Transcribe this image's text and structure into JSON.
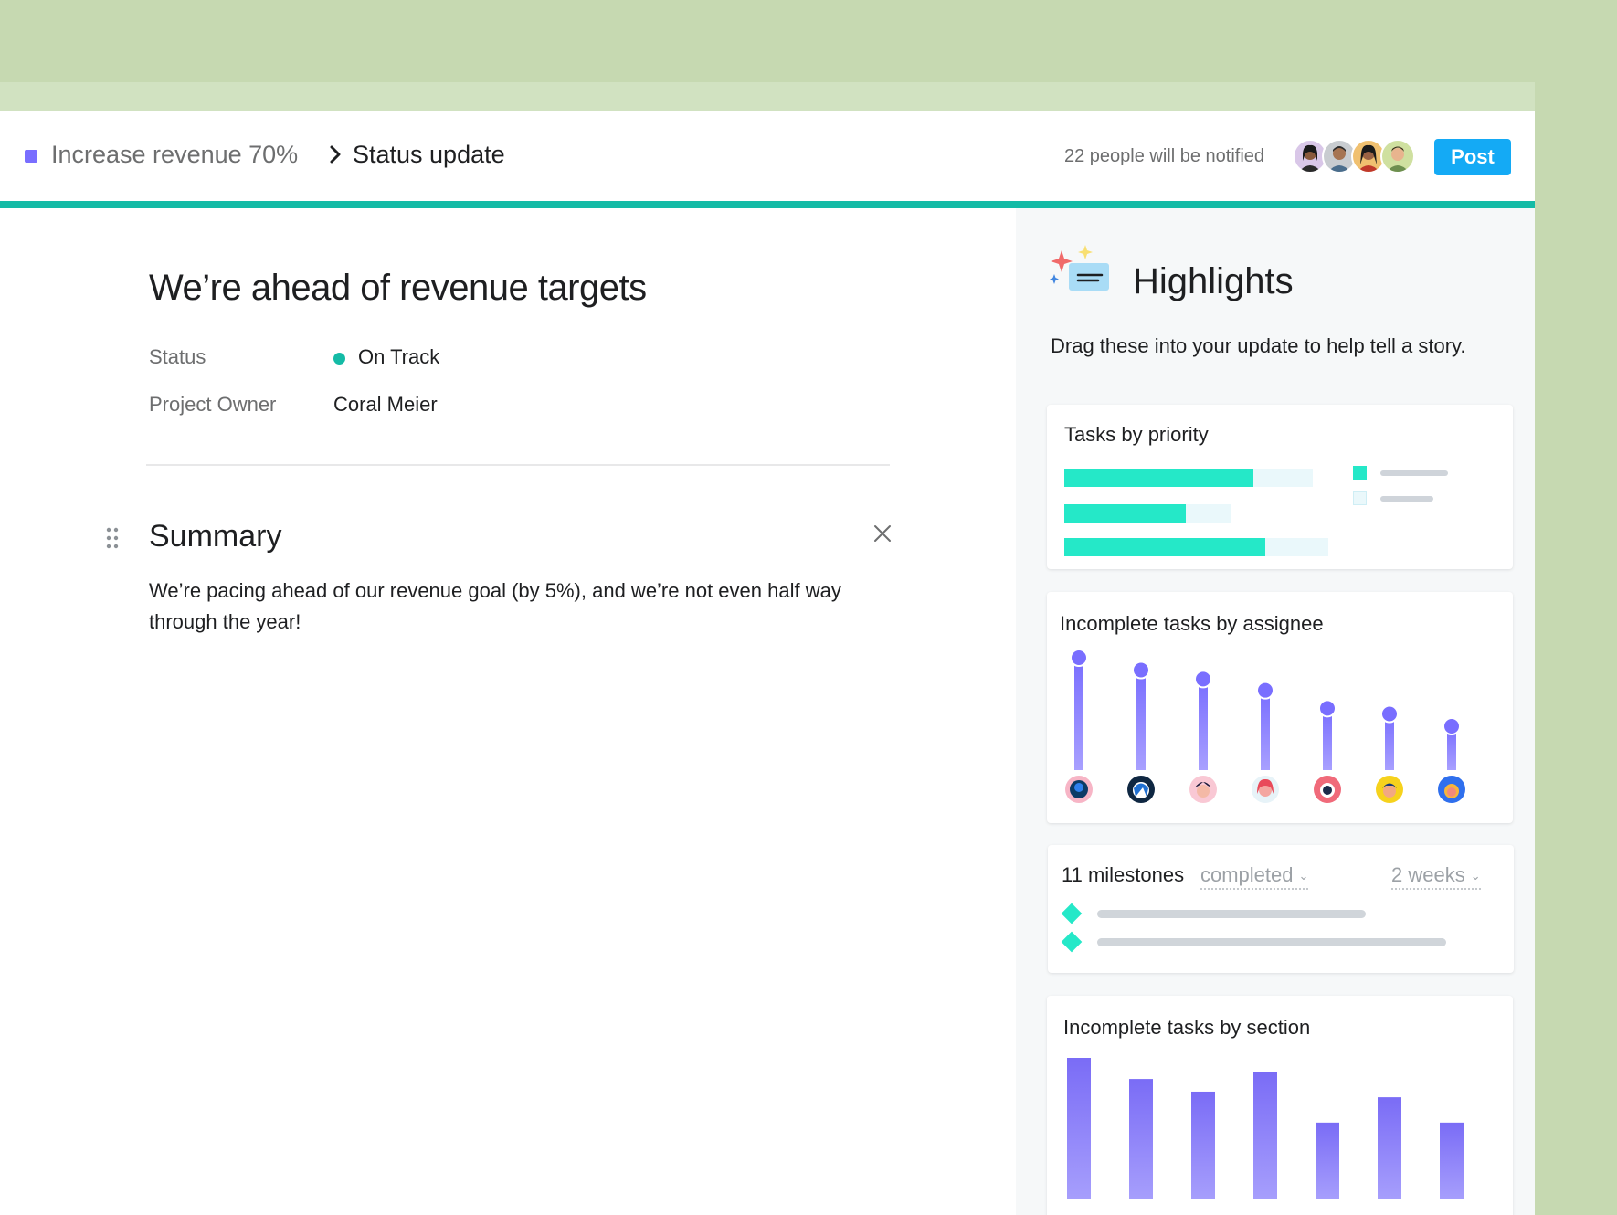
{
  "header": {
    "project_name": "Increase revenue 70%",
    "page_name": "Status update",
    "notify_text": "22 people will be notified",
    "post_label": "Post",
    "avatars": [
      "avatar-1",
      "avatar-2",
      "avatar-3",
      "avatar-4"
    ]
  },
  "update": {
    "title": "We’re ahead of revenue targets",
    "fields": {
      "status_label": "Status",
      "status_value": "On Track",
      "owner_label": "Project Owner",
      "owner_value": "Coral Meier"
    },
    "summary": {
      "heading": "Summary",
      "body": "We’re pacing ahead of our revenue goal (by 5%), and we’re not even half way through the year!"
    }
  },
  "highlights": {
    "title": "Highlights",
    "subtitle": "Drag these into your update to help tell a story.",
    "cards": {
      "tasks_by_priority": {
        "title": "Tasks by priority"
      },
      "by_assignee": {
        "title": "Incomplete tasks by assignee"
      },
      "milestones": {
        "title": "11 milestones",
        "filter_value": "completed",
        "range_value": "2 weeks"
      },
      "by_section": {
        "title": "Incomplete tasks by section"
      }
    }
  },
  "colors": {
    "accent": "#796eff",
    "status_on_track": "#14bba6",
    "post_button": "#14aaf5",
    "chart_teal": "#25e8c8",
    "chart_purple": "#796eff",
    "background": "#c6d9b1"
  },
  "chart_data": [
    {
      "type": "bar",
      "orientation": "horizontal",
      "categories": [
        "",
        "",
        ""
      ],
      "series": [
        {
          "values": [
            0.76,
            0.73,
            0.76
          ]
        }
      ]
    },
    {
      "type": "bar",
      "categories": [
        "",
        "",
        "",
        "",
        "",
        "",
        ""
      ],
      "values": [
        100,
        89,
        81,
        71,
        55,
        50,
        39
      ]
    },
    {
      "type": "bar",
      "categories": [
        "",
        "",
        "",
        "",
        "",
        "",
        ""
      ],
      "values": [
        100,
        85,
        76,
        90,
        54,
        72,
        54
      ]
    }
  ]
}
